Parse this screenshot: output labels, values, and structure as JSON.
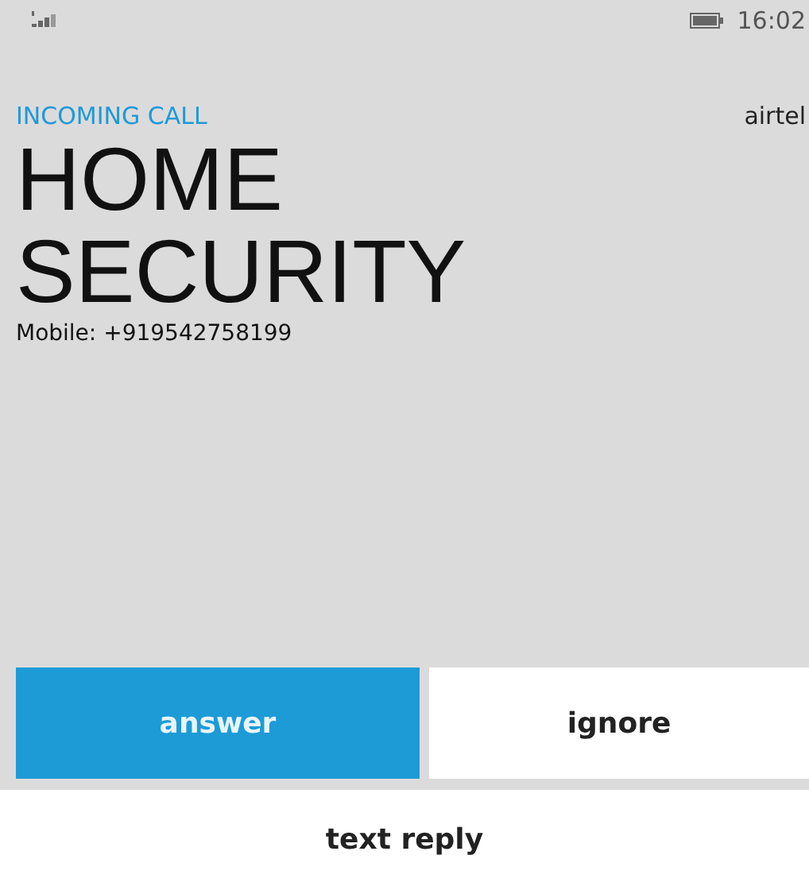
{
  "status_bar": {
    "time": "16:02"
  },
  "call": {
    "label": "INCOMING CALL",
    "carrier": "airtel",
    "caller": "HOME SECURITY",
    "number": "Mobile: +919542758199"
  },
  "buttons": [
    {
      "label": "answer",
      "kind": "primary"
    },
    {
      "label": "ignore",
      "kind": "secondary"
    }
  ],
  "text_reply": "text reply"
}
